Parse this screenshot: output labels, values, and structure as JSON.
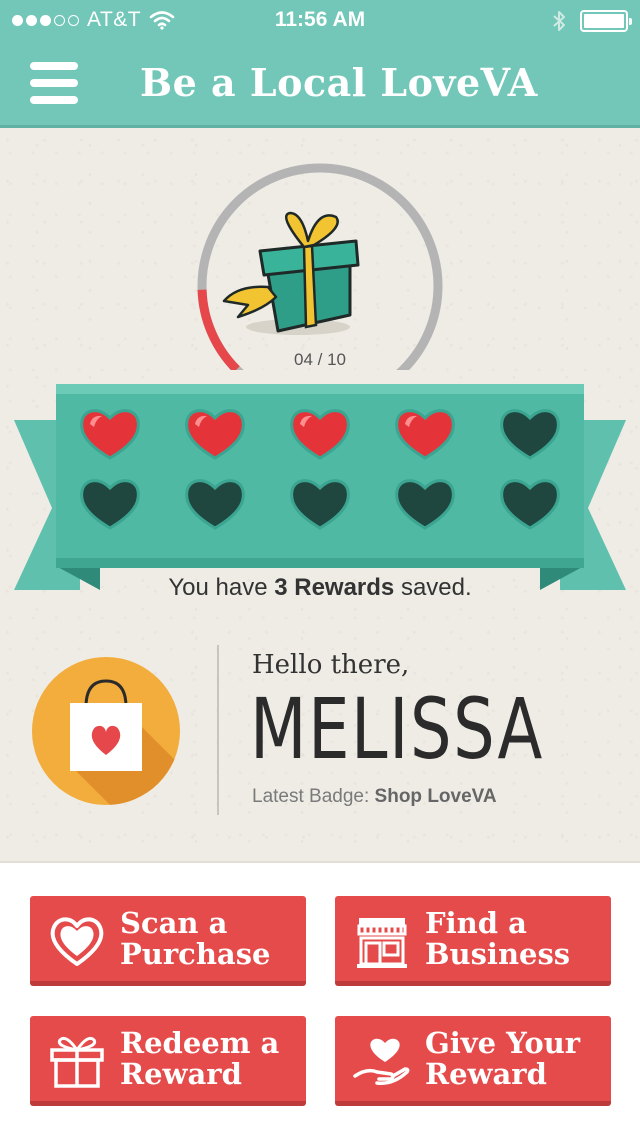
{
  "status_bar": {
    "carrier": "AT&T",
    "time": "11:56 AM",
    "signal_bars": 3,
    "signal_total": 5,
    "icons": [
      "wifi-icon",
      "bluetooth-icon",
      "battery-icon"
    ]
  },
  "nav": {
    "title": "Be a Local LoveVA",
    "menu_icon": "hamburger-icon"
  },
  "progress": {
    "count_label": "04 / 10",
    "current": 4,
    "total": 10,
    "icon": "gift-icon"
  },
  "hearts": {
    "filled": 4,
    "total": 10
  },
  "rewards": {
    "prefix": "You have ",
    "emphasis": "3 Rewards",
    "suffix": " saved."
  },
  "profile": {
    "greeting": "Hello there,",
    "name": "MELISSA",
    "badge_label": "Latest Badge: ",
    "badge_name": "Shop LoveVA",
    "badge_icon": "shopping-bag-icon"
  },
  "actions": [
    {
      "label": "Scan a\nPurchase",
      "icon": "heart-icon"
    },
    {
      "label": "Find a\nBusiness",
      "icon": "storefront-icon"
    },
    {
      "label": "Redeem a\nReward",
      "icon": "gift-icon"
    },
    {
      "label": "Give Your\nReward",
      "icon": "heart-hand-icon"
    }
  ],
  "colors": {
    "teal": "#72c7b8",
    "red": "#e54b4b",
    "orange": "#f2ad3c"
  }
}
